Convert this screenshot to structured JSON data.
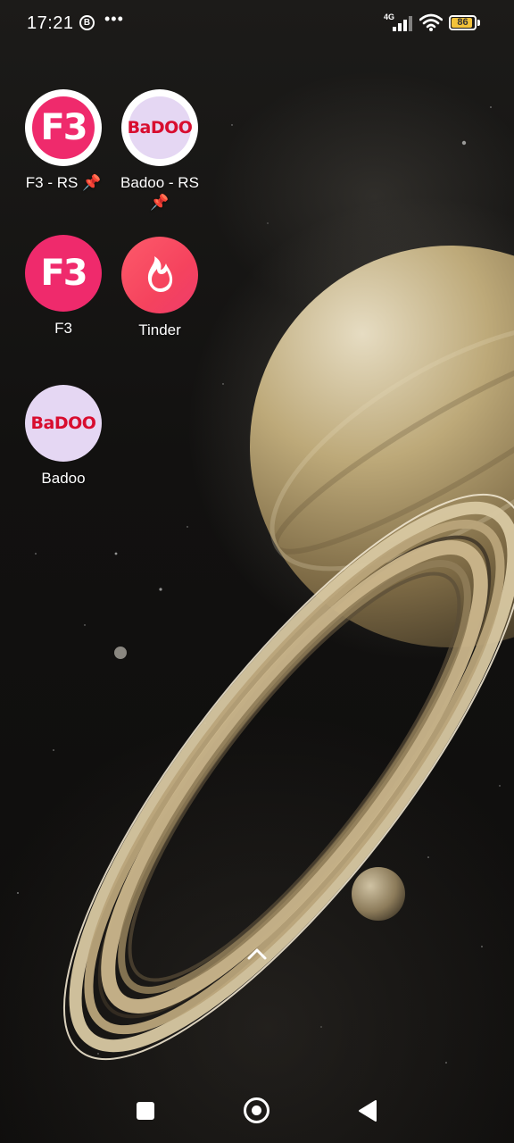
{
  "status_bar": {
    "time": "17:21",
    "notification_badge": "B",
    "more_indicator": "•••",
    "network_type": "4G",
    "battery_percent": "86",
    "battery_level": 0.86,
    "battery_color": "#f3c33a",
    "icons": [
      "b-notification-icon",
      "signal-icon",
      "wifi-icon",
      "battery-icon"
    ]
  },
  "home_screen": {
    "apps": [
      {
        "label": "F3 - RS 📌",
        "icon": "f3-icon",
        "icon_text": "F3",
        "style": "outlined",
        "color": "#ef2a6c"
      },
      {
        "label": "Badoo - RS 📌",
        "icon": "badoo-icon",
        "icon_text": "BaDOO",
        "style": "outlined",
        "color": "#d80d2f"
      },
      {
        "label": "F3",
        "icon": "f3-icon",
        "icon_text": "F3",
        "style": "solid",
        "color": "#ef2a6c"
      },
      {
        "label": "Tinder",
        "icon": "tinder-flame-icon",
        "icon_text": "",
        "style": "solid",
        "color": "#f5435e"
      },
      {
        "label": "Badoo",
        "icon": "badoo-icon",
        "icon_text": "BaDOO",
        "style": "solid",
        "color": "#d80d2f"
      }
    ],
    "app_drawer_hint_icon": "chevron-up-icon"
  },
  "nav_bar": {
    "buttons": [
      {
        "name": "recents",
        "icon": "square-icon"
      },
      {
        "name": "home",
        "icon": "circle-icon"
      },
      {
        "name": "back",
        "icon": "triangle-back-icon"
      }
    ]
  },
  "wallpaper": {
    "subject": "saturn-wallpaper",
    "colors": {
      "planet": "#9c8a66",
      "rings": "#c9b896",
      "space": "#121110"
    }
  }
}
